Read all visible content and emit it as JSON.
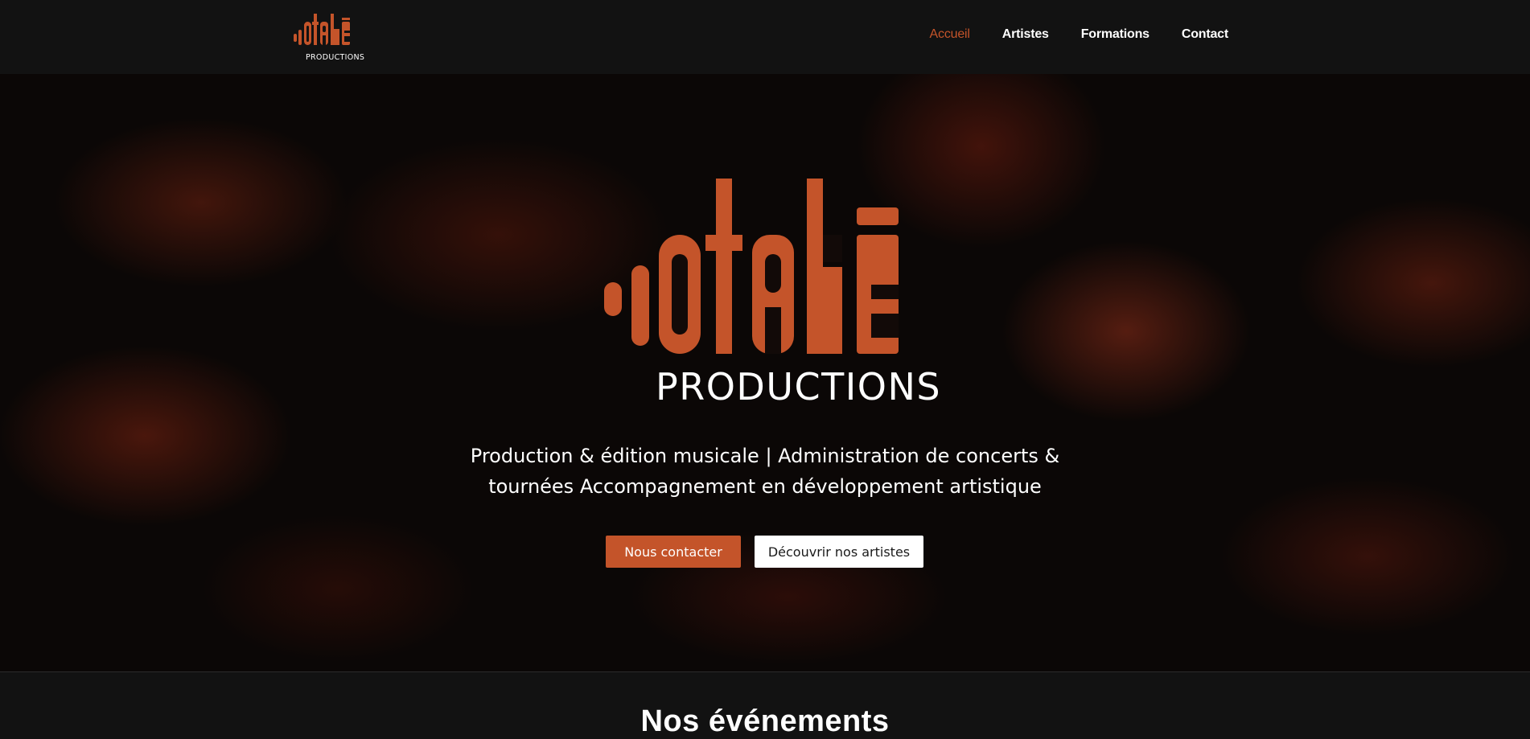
{
  "brand": {
    "logo_text": "otakē",
    "logo_subtitle": "PRODUCTIONS",
    "accent_color": "#c4542a"
  },
  "nav": {
    "items": [
      {
        "label": "Accueil",
        "active": true
      },
      {
        "label": "Artistes",
        "active": false
      },
      {
        "label": "Formations",
        "active": false
      },
      {
        "label": "Contact",
        "active": false
      }
    ]
  },
  "hero": {
    "subtitle": "PRODUCTIONS",
    "tagline_line1": "Production & édition musicale | Administration de concerts &",
    "tagline_line2": "tournées Accompagnement en développement artistique",
    "primary_button": "Nous contacter",
    "secondary_button": "Découvrir nos artistes"
  },
  "events": {
    "heading": "Nos événements"
  }
}
